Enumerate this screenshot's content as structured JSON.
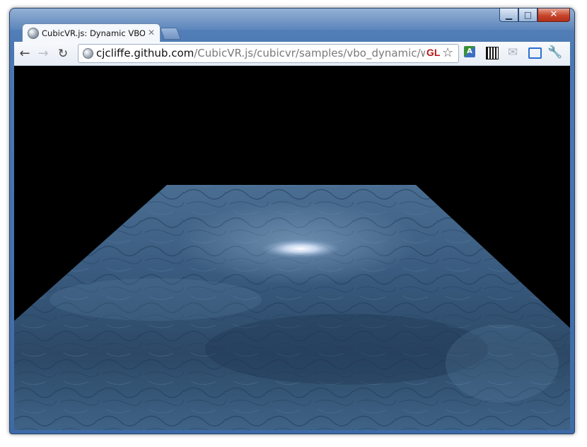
{
  "window": {
    "controls": {
      "minimize": "▁",
      "maximize": "□",
      "close": "✕"
    }
  },
  "tab": {
    "title": "CubicVR.js: Dynamic VBO wave",
    "close_glyph": "✕"
  },
  "toolbar": {
    "back": "←",
    "forward": "→",
    "reload": "↻",
    "url_host": "cjcliffe.github.com",
    "url_path": "/CubicVR.js/cubicvr/samples/vbo_dynamic/wave_pc",
    "gl_badge": "GL",
    "star": "☆",
    "extensions": {
      "translate": "A",
      "mail": "✉",
      "wrench": "🔧"
    }
  },
  "scene": {
    "background": "#000000",
    "plane_color": "#3b5a7a",
    "highlight_color": "#ffffff"
  }
}
